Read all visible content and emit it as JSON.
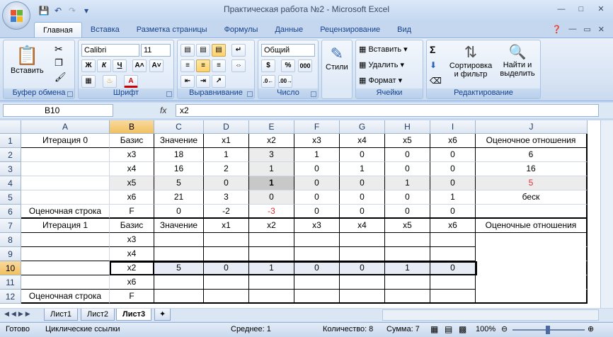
{
  "window": {
    "title": "Практическая работа №2 - Microsoft Excel"
  },
  "tabs": [
    "Главная",
    "Вставка",
    "Разметка страницы",
    "Формулы",
    "Данные",
    "Рецензирование",
    "Вид"
  ],
  "ribbon": {
    "clipboard": {
      "label": "Буфер обмена",
      "paste": "Вставить"
    },
    "font": {
      "label": "Шрифт",
      "name": "Calibri",
      "size": "11",
      "bold": "Ж",
      "italic": "К",
      "underline": "Ч"
    },
    "alignment": {
      "label": "Выравнивание"
    },
    "number": {
      "label": "Число",
      "format": "Общий",
      "percent": "%",
      "thousands": "000"
    },
    "styles": {
      "label": "Стили"
    },
    "cells": {
      "label": "Ячейки",
      "insert": "Вставить",
      "delete": "Удалить",
      "format": "Формат"
    },
    "editing": {
      "label": "Редактирование",
      "sort": "Сортировка и фильтр",
      "find": "Найти и выделить"
    }
  },
  "formula_bar": {
    "name_box": "B10",
    "fx": "fx",
    "value": "x2"
  },
  "columns": [
    "A",
    "B",
    "C",
    "D",
    "E",
    "F",
    "G",
    "H",
    "I",
    "J"
  ],
  "rows": [
    [
      "Итерация 0",
      "Базис",
      "Значение",
      "x1",
      "x2",
      "x3",
      "x4",
      "x5",
      "x6",
      "Оценочное отношения"
    ],
    [
      "",
      "x3",
      "18",
      "1",
      "3",
      "1",
      "0",
      "0",
      "0",
      "6"
    ],
    [
      "",
      "x4",
      "16",
      "2",
      "1",
      "0",
      "1",
      "0",
      "0",
      "16"
    ],
    [
      "",
      "x5",
      "5",
      "0",
      "1",
      "0",
      "0",
      "1",
      "0",
      "5"
    ],
    [
      "",
      "x6",
      "21",
      "3",
      "0",
      "0",
      "0",
      "0",
      "1",
      "беск"
    ],
    [
      "Оценочная строка",
      "F",
      "0",
      "-2",
      "-3",
      "0",
      "0",
      "0",
      "0",
      ""
    ],
    [
      "Итерация 1",
      "Базис",
      "Значение",
      "x1",
      "x2",
      "x3",
      "x4",
      "x5",
      "x6",
      "Оценочные отношения"
    ],
    [
      "",
      "x3",
      "",
      "",
      "",
      "",
      "",
      "",
      "",
      ""
    ],
    [
      "",
      "x4",
      "",
      "",
      "",
      "",
      "",
      "",
      "",
      ""
    ],
    [
      "",
      "x2",
      "5",
      "0",
      "1",
      "0",
      "0",
      "1",
      "0",
      ""
    ],
    [
      "",
      "x6",
      "",
      "",
      "",
      "",
      "",
      "",
      "",
      ""
    ],
    [
      "Оценочная строка",
      "F",
      "",
      "",
      "",
      "",
      "",
      "",
      "",
      ""
    ]
  ],
  "sheets": [
    "Лист1",
    "Лист2",
    "Лист3"
  ],
  "active_sheet": "Лист3",
  "status": {
    "ready": "Готово",
    "circular": "Циклические ссылки",
    "average": "Среднее: 1",
    "count": "Количество: 8",
    "sum": "Сумма: 7",
    "zoom": "100%"
  },
  "colors": {
    "red": "#e03030",
    "selected_header": "#f4c76a",
    "shaded": "#d9d9d9"
  }
}
